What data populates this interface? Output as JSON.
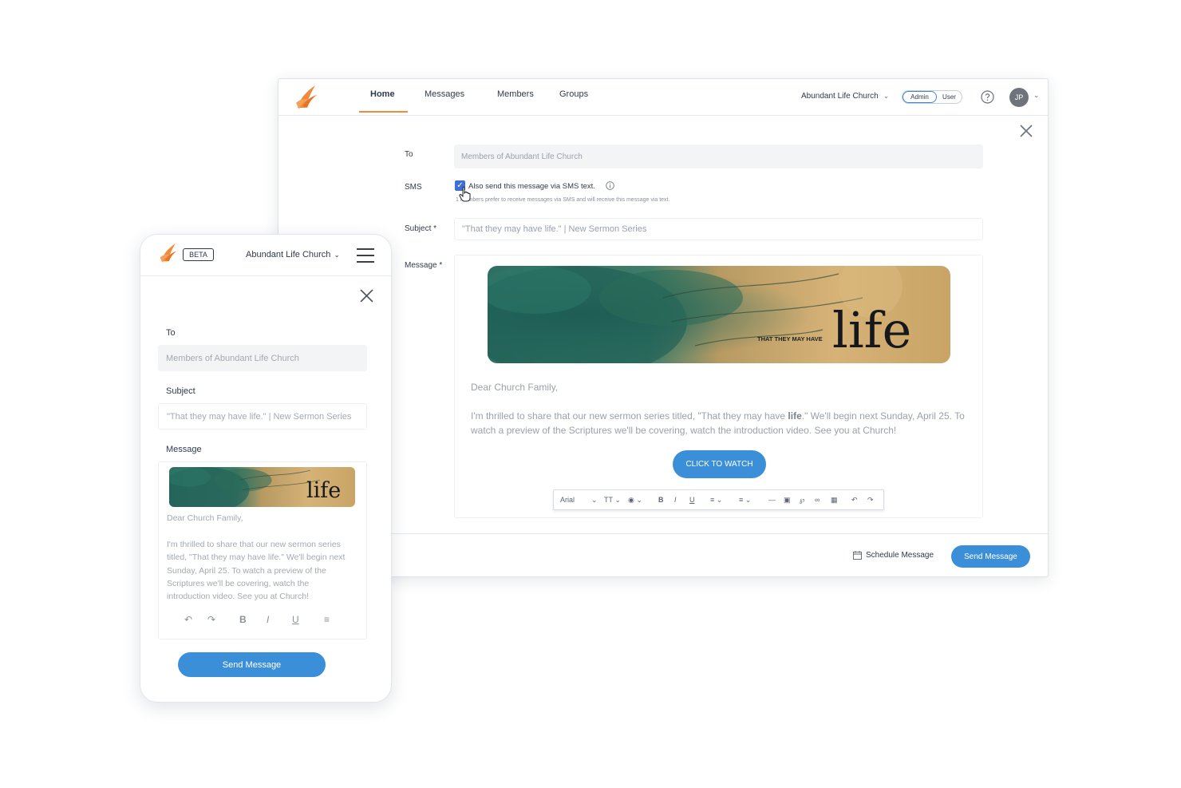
{
  "colors": {
    "accent": "#3b8fd9",
    "brand_orange": "#f08a3e",
    "checkbox": "#3d6fd6"
  },
  "desktop": {
    "nav": {
      "tabs": [
        {
          "label": "Home",
          "active": true
        },
        {
          "label": "Messages",
          "active": false
        },
        {
          "label": "Members",
          "active": false
        },
        {
          "label": "Groups",
          "active": false
        }
      ],
      "church": "Abundant Life Church",
      "role_admin": "Admin",
      "role_user": "User",
      "avatar_initials": "JP"
    },
    "form": {
      "to_label": "To",
      "to_value": "Members of Abundant Life Church",
      "sms_label": "SMS",
      "sms_checkbox_text": "Also send this message via SMS text.",
      "sms_checked": true,
      "sms_note": "1 members prefer to receive messages via SMS and will receive this message via text.",
      "subject_label": "Subject *",
      "subject_value": "\"That they may have life.\" | New Sermon Series",
      "message_label": "Message *"
    },
    "message": {
      "banner_small": "THAT THEY MAY HAVE",
      "banner_big": "life",
      "greeting": "Dear Church Family,",
      "body_before": "I'm thrilled to share that our new sermon series titled, \"That they may have ",
      "body_bold": "life",
      "body_after": ".\" We'll begin next Sunday, April 25. To watch a preview of the Scriptures we'll be covering, watch the introduction video. See you at Church!",
      "cta": "CLICK TO WATCH"
    },
    "toolbar": {
      "font": "Arial",
      "size": "TT"
    },
    "footer": {
      "schedule": "Schedule Message",
      "send": "Send Message"
    }
  },
  "mobile": {
    "beta": "BETA",
    "church": "Abundant Life Church",
    "to_label": "To",
    "to_value": "Members of Abundant Life Church",
    "subject_label": "Subject",
    "subject_value": "\"That they may have life.\" | New Sermon Series",
    "message_label": "Message",
    "banner_big": "life",
    "greeting": "Dear Church Family,",
    "body": "I'm thrilled to share that our new sermon series titled, \"That they may have life.\" We'll begin next Sunday, April 25. To watch a preview of the Scriptures we'll be covering, watch the introduction video. See you at Church!",
    "send": "Send Message"
  }
}
